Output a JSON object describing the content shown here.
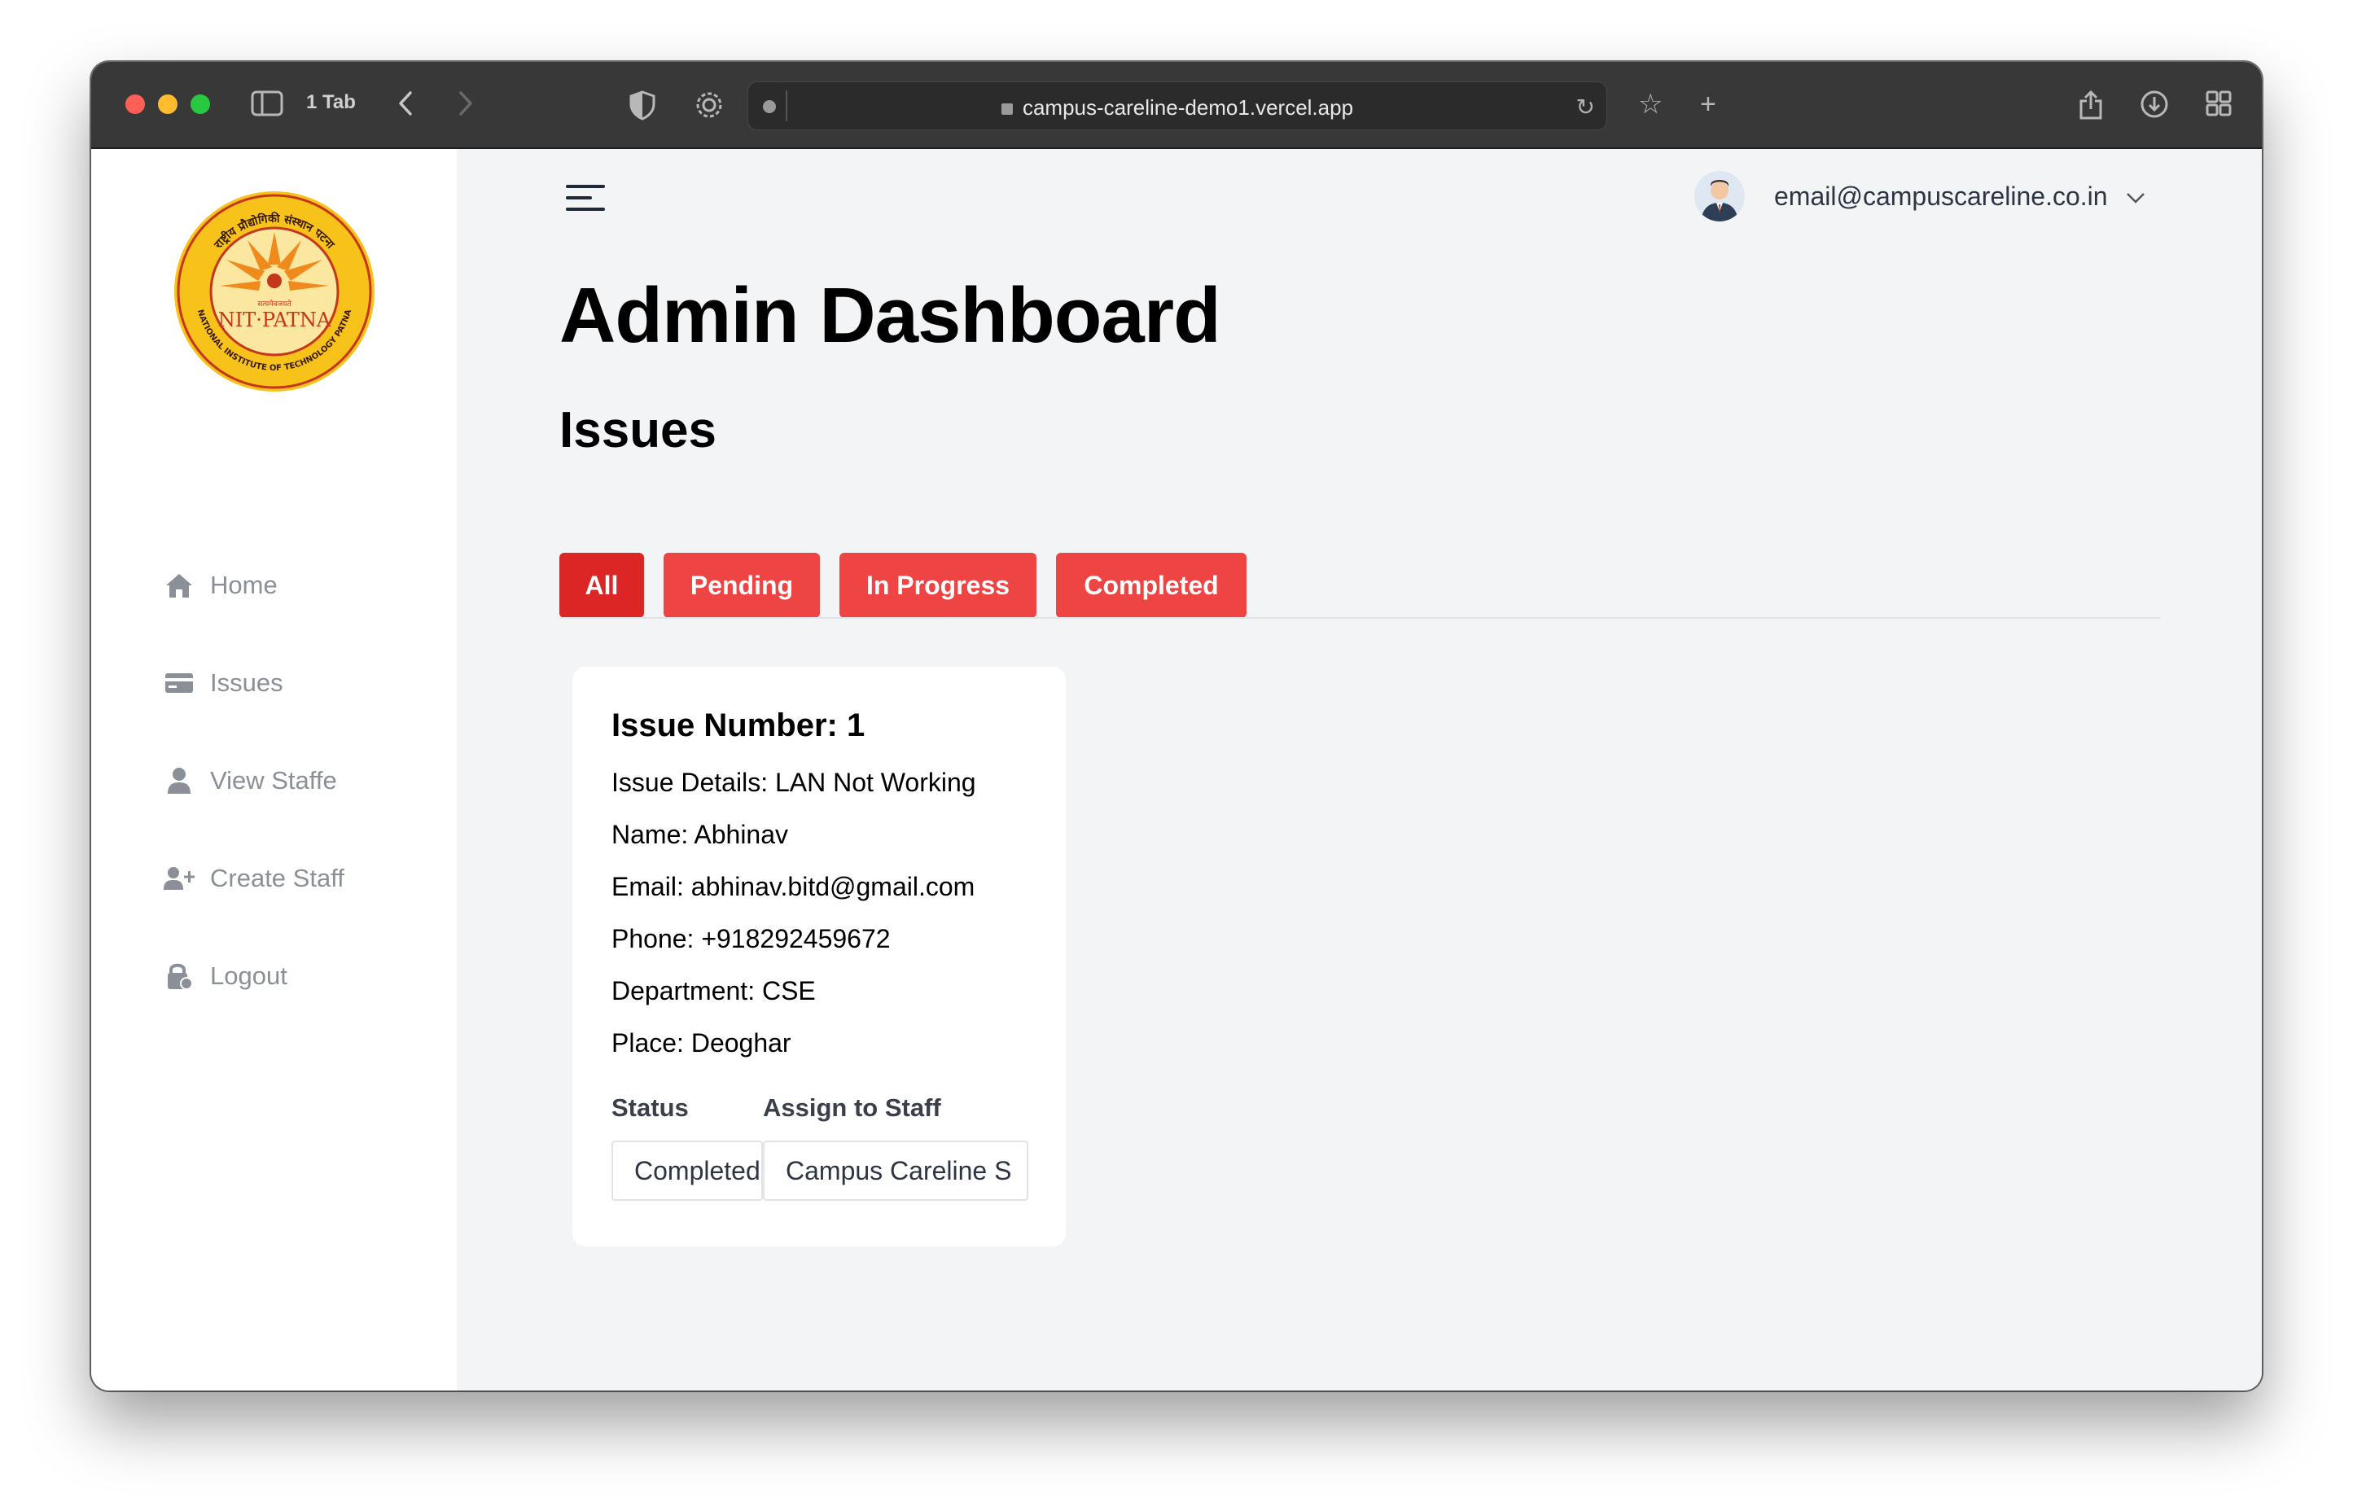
{
  "browser": {
    "tab_count": "1 Tab",
    "url": "campus-careline-demo1.vercel.app"
  },
  "logo": {
    "top_text": "राष्ट्रीय प्रौद्योगिकी संस्थान पटना",
    "center_text": "NIT·PATNA",
    "motto": "सत्यमेवजयते",
    "bottom_text": "NATIONAL INSTITUTE OF TECHNOLOGY PATNA"
  },
  "sidebar": {
    "items": [
      {
        "label": "Home",
        "icon": "home-icon"
      },
      {
        "label": "Issues",
        "icon": "card-icon"
      },
      {
        "label": "View Staffe",
        "icon": "user-icon"
      },
      {
        "label": "Create Staff",
        "icon": "user-plus-icon"
      },
      {
        "label": "Logout",
        "icon": "lock-icon"
      }
    ]
  },
  "header": {
    "user_email": "email@campuscareline.co.in"
  },
  "main": {
    "page_title": "Admin Dashboard",
    "section_title": "Issues",
    "tabs": [
      {
        "label": "All",
        "active": true
      },
      {
        "label": "Pending",
        "active": false
      },
      {
        "label": "In Progress",
        "active": false
      },
      {
        "label": "Completed",
        "active": false
      }
    ]
  },
  "issue": {
    "title": "Issue Number: 1",
    "details": "Issue Details: LAN Not Working",
    "name": "Name: Abhinav",
    "email": "Email: abhinav.bitd@gmail.com",
    "phone": "Phone: +918292459672",
    "department": "Department: CSE",
    "place": "Place: Deoghar",
    "status_label": "Status",
    "assign_label": "Assign to Staff",
    "status_value": "Completed",
    "assign_value": "Campus Careline S"
  },
  "colors": {
    "accent_active": "#dc2626",
    "accent": "#ef4444"
  }
}
